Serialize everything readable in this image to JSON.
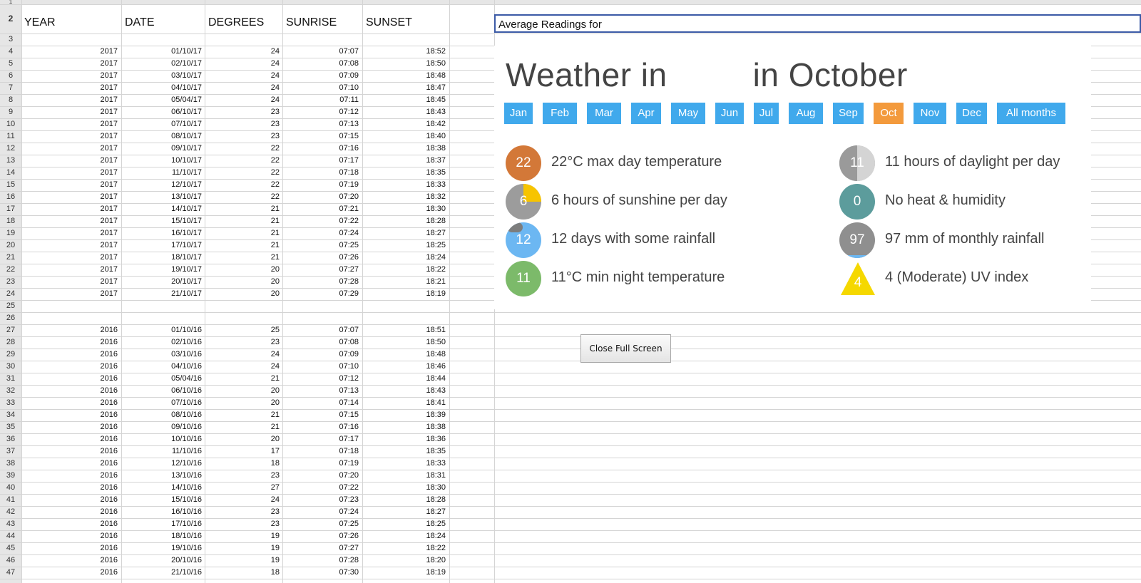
{
  "spreadsheet": {
    "headers": [
      "YEAR",
      "DATE",
      "DEGREES",
      "SUNRISE",
      "SUNSET"
    ],
    "block_2017": [
      [
        "2017",
        "01/10/17",
        "24",
        "07:07",
        "18:52"
      ],
      [
        "2017",
        "02/10/17",
        "24",
        "07:08",
        "18:50"
      ],
      [
        "2017",
        "03/10/17",
        "24",
        "07:09",
        "18:48"
      ],
      [
        "2017",
        "04/10/17",
        "24",
        "07:10",
        "18:47"
      ],
      [
        "2017",
        "05/04/17",
        "24",
        "07:11",
        "18:45"
      ],
      [
        "2017",
        "06/10/17",
        "23",
        "07:12",
        "18:43"
      ],
      [
        "2017",
        "07/10/17",
        "23",
        "07:13",
        "18:42"
      ],
      [
        "2017",
        "08/10/17",
        "23",
        "07:15",
        "18:40"
      ],
      [
        "2017",
        "09/10/17",
        "22",
        "07:16",
        "18:38"
      ],
      [
        "2017",
        "10/10/17",
        "22",
        "07:17",
        "18:37"
      ],
      [
        "2017",
        "11/10/17",
        "22",
        "07:18",
        "18:35"
      ],
      [
        "2017",
        "12/10/17",
        "22",
        "07:19",
        "18:33"
      ],
      [
        "2017",
        "13/10/17",
        "22",
        "07:20",
        "18:32"
      ],
      [
        "2017",
        "14/10/17",
        "21",
        "07:21",
        "18:30"
      ],
      [
        "2017",
        "15/10/17",
        "21",
        "07:22",
        "18:28"
      ],
      [
        "2017",
        "16/10/17",
        "21",
        "07:24",
        "18:27"
      ],
      [
        "2017",
        "17/10/17",
        "21",
        "07:25",
        "18:25"
      ],
      [
        "2017",
        "18/10/17",
        "21",
        "07:26",
        "18:24"
      ],
      [
        "2017",
        "19/10/17",
        "20",
        "07:27",
        "18:22"
      ],
      [
        "2017",
        "20/10/17",
        "20",
        "07:28",
        "18:21"
      ],
      [
        "2017",
        "21/10/17",
        "20",
        "07:29",
        "18:19"
      ]
    ],
    "block_2016": [
      [
        "2016",
        "01/10/16",
        "25",
        "07:07",
        "18:51"
      ],
      [
        "2016",
        "02/10/16",
        "23",
        "07:08",
        "18:50"
      ],
      [
        "2016",
        "03/10/16",
        "24",
        "07:09",
        "18:48"
      ],
      [
        "2016",
        "04/10/16",
        "24",
        "07:10",
        "18:46"
      ],
      [
        "2016",
        "05/04/16",
        "21",
        "07:12",
        "18:44"
      ],
      [
        "2016",
        "06/10/16",
        "20",
        "07:13",
        "18:43"
      ],
      [
        "2016",
        "07/10/16",
        "20",
        "07:14",
        "18:41"
      ],
      [
        "2016",
        "08/10/16",
        "21",
        "07:15",
        "18:39"
      ],
      [
        "2016",
        "09/10/16",
        "21",
        "07:16",
        "18:38"
      ],
      [
        "2016",
        "10/10/16",
        "20",
        "07:17",
        "18:36"
      ],
      [
        "2016",
        "11/10/16",
        "17",
        "07:18",
        "18:35"
      ],
      [
        "2016",
        "12/10/16",
        "18",
        "07:19",
        "18:33"
      ],
      [
        "2016",
        "13/10/16",
        "23",
        "07:20",
        "18:31"
      ],
      [
        "2016",
        "14/10/16",
        "27",
        "07:22",
        "18:30"
      ],
      [
        "2016",
        "15/10/16",
        "24",
        "07:23",
        "18:28"
      ],
      [
        "2016",
        "16/10/16",
        "23",
        "07:24",
        "18:27"
      ],
      [
        "2016",
        "17/10/16",
        "23",
        "07:25",
        "18:25"
      ],
      [
        "2016",
        "18/10/16",
        "19",
        "07:26",
        "18:24"
      ],
      [
        "2016",
        "19/10/16",
        "19",
        "07:27",
        "18:22"
      ],
      [
        "2016",
        "20/10/16",
        "19",
        "07:28",
        "18:20"
      ],
      [
        "2016",
        "21/10/16",
        "18",
        "07:30",
        "18:19"
      ]
    ],
    "f2_text": "Average Readings for"
  },
  "widget": {
    "title_prefix": "Weather in",
    "title_suffix": "in October",
    "months": [
      "Jan",
      "Feb",
      "Mar",
      "Apr",
      "May",
      "Jun",
      "Jul",
      "Aug",
      "Sep",
      "Oct",
      "Nov",
      "Dec",
      "All months"
    ],
    "active_month": "Oct",
    "stats_left": [
      {
        "badge": "22",
        "text": "22°C max day temperature",
        "color": "#d37838"
      },
      {
        "badge": "6",
        "text": "6 hours of sunshine per day",
        "color": "#9c9c9c",
        "accent": "#f7c400"
      },
      {
        "badge": "12",
        "text": "12 days with some rainfall",
        "color": "#6cb7f2"
      },
      {
        "badge": "11",
        "text": "11°C min night temperature",
        "color": "#7cba6a"
      }
    ],
    "stats_right": [
      {
        "badge": "11",
        "text": "11 hours of daylight per day",
        "color": "#a9a9a9"
      },
      {
        "badge": "0",
        "text": "No heat & humidity",
        "color": "#5c9c9c"
      },
      {
        "badge": "97",
        "text": "97 mm of monthly rainfall",
        "color": "#8f8f8f",
        "accent": "#6cb7f2"
      },
      {
        "badge": "4",
        "text": "4 (Moderate) UV index",
        "color": "#f5d800"
      }
    ]
  },
  "close_button": {
    "label": "Close Full Screen"
  },
  "row_numbers": [
    "1",
    "2",
    "3",
    "4",
    "5",
    "6",
    "7",
    "8",
    "9",
    "10",
    "11",
    "12",
    "13",
    "14",
    "15",
    "16",
    "17",
    "18",
    "19",
    "20",
    "21",
    "22",
    "23",
    "24",
    "25",
    "26",
    "27",
    "28",
    "29",
    "30",
    "31",
    "32",
    "33",
    "34",
    "35",
    "36",
    "37",
    "38",
    "39",
    "40",
    "41",
    "42",
    "43",
    "44",
    "45",
    "46",
    "47"
  ]
}
